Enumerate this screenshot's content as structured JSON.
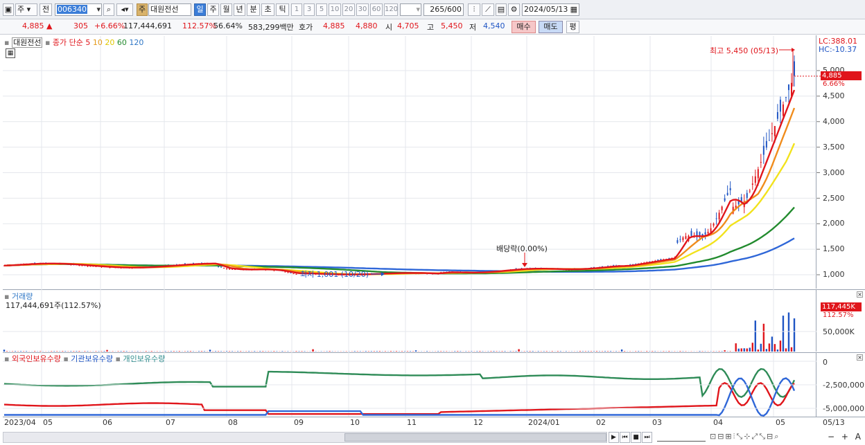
{
  "toolbar": {
    "market_type": "주",
    "market_type2": "전",
    "code": "006340",
    "stock_name": "대원전선",
    "period_badge": "주",
    "periods": [
      "일",
      "주",
      "월",
      "년",
      "분",
      "초",
      "틱"
    ],
    "intervals": [
      "1",
      "3",
      "5",
      "10",
      "20",
      "30",
      "60",
      "120"
    ],
    "count": "265",
    "max_count": "/600",
    "date": "2024/05/13"
  },
  "info": {
    "price": "4,885",
    "change_arrow": "▲",
    "change": "305",
    "change_pct": "+6.66%",
    "volume": "117,444,691",
    "volume_ratio": "112.57%",
    "turnover": "56.64%",
    "trade_value": "583,299백만",
    "quote_label": "호가",
    "ask": "4,885",
    "bid": "4,880",
    "open_label": "시",
    "open": "4,705",
    "high_label": "고",
    "high": "5,450",
    "low_label": "저",
    "low": "4,540",
    "buy_btn": "매수",
    "sell_btn": "매도",
    "eval_btn": "평"
  },
  "legend": {
    "stock": "대원전선",
    "series": "종가 단순",
    "ma": [
      "5",
      "10",
      "20",
      "60",
      "120"
    ]
  },
  "annotations": {
    "high_label": "최고 5,450 (05/13)",
    "low_label": "최저 1,001 (10/20)",
    "dividend_label": "배당락(0.00%)"
  },
  "axis_top": {
    "lc": "LC:388.01",
    "hc": "HC:-10.37"
  },
  "price_axis": {
    "ticks": [
      "5,000",
      "4,500",
      "4,000",
      "3,500",
      "3,000",
      "2,500",
      "2,000",
      "1,500",
      "1,000"
    ],
    "cur_price": "4,885",
    "cur_pct": "6.66%"
  },
  "volume_panel": {
    "title": "거래량",
    "value": "117,444,691주(112.57%)",
    "tick": "50,000K",
    "tag": "117,445K",
    "pct": "112.57%"
  },
  "holdings_panel": {
    "foreign": "외국인보유수량",
    "inst": "기관보유수량",
    "indiv": "개인보유수량",
    "ticks": [
      "0",
      "-2,500,000",
      "-5,000,000"
    ]
  },
  "x_axis": [
    "2023/04",
    "05",
    "06",
    "07",
    "08",
    "09",
    "10",
    "11",
    "12",
    "2024/01",
    "02",
    "03",
    "04",
    "05",
    "05/13"
  ],
  "colors": {
    "up": "#e0151b",
    "down": "#1f55c4",
    "ma5": "#e0151b",
    "ma10": "#f08c1c",
    "ma20": "#f2e21c",
    "ma60": "#228b2e",
    "ma120": "#2f67d8"
  },
  "chart_data": {
    "type": "candlestick",
    "x": [
      "2023/04",
      "2023/05",
      "2023/06",
      "2023/07",
      "2023/08",
      "2023/09",
      "2023/10",
      "2023/11",
      "2023/12",
      "2024/01",
      "2024/02",
      "2024/03",
      "2024/04",
      "2024/05",
      "2024/05/13"
    ],
    "close": [
      1200,
      1220,
      1240,
      1250,
      1200,
      1120,
      1050,
      1080,
      1120,
      1150,
      1200,
      1300,
      1950,
      3300,
      4885
    ],
    "ma60": [
      1150,
      1180,
      1200,
      1210,
      1200,
      1170,
      1100,
      1080,
      1100,
      1120,
      1150,
      1230,
      1450,
      1800,
      1980
    ],
    "ma120": [
      1120,
      1140,
      1160,
      1180,
      1180,
      1160,
      1120,
      1080,
      1080,
      1100,
      1120,
      1170,
      1280,
      1450,
      1560
    ],
    "ylim": [
      800,
      5450
    ],
    "volume_k": [
      1500,
      2000,
      1500,
      3000,
      2200,
      1000,
      800,
      900,
      1500,
      1400,
      1700,
      9000,
      77000,
      117445,
      117445
    ],
    "high": 5450,
    "low": 1001
  }
}
